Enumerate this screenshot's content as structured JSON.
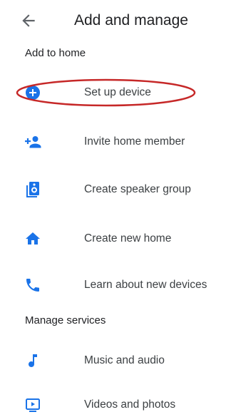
{
  "header": {
    "back_icon": "arrow-left-icon",
    "title": "Add and manage"
  },
  "sections": [
    {
      "title": "Add to home",
      "items": [
        {
          "label": "Set up device",
          "icon": "add-circle-icon"
        },
        {
          "label": "Invite home member",
          "icon": "person-add-icon"
        },
        {
          "label": "Create speaker group",
          "icon": "speaker-group-icon"
        },
        {
          "label": "Create new home",
          "icon": "home-icon"
        },
        {
          "label": "Learn about new devices",
          "icon": "phone-icon"
        }
      ]
    },
    {
      "title": "Manage services",
      "items": [
        {
          "label": "Music and audio",
          "icon": "music-note-icon"
        },
        {
          "label": "Videos and photos",
          "icon": "video-icon"
        }
      ]
    }
  ],
  "colors": {
    "accent": "#1a73e8",
    "text_primary": "#202124",
    "text_secondary": "#3c4043",
    "annotation": "#c62828"
  }
}
